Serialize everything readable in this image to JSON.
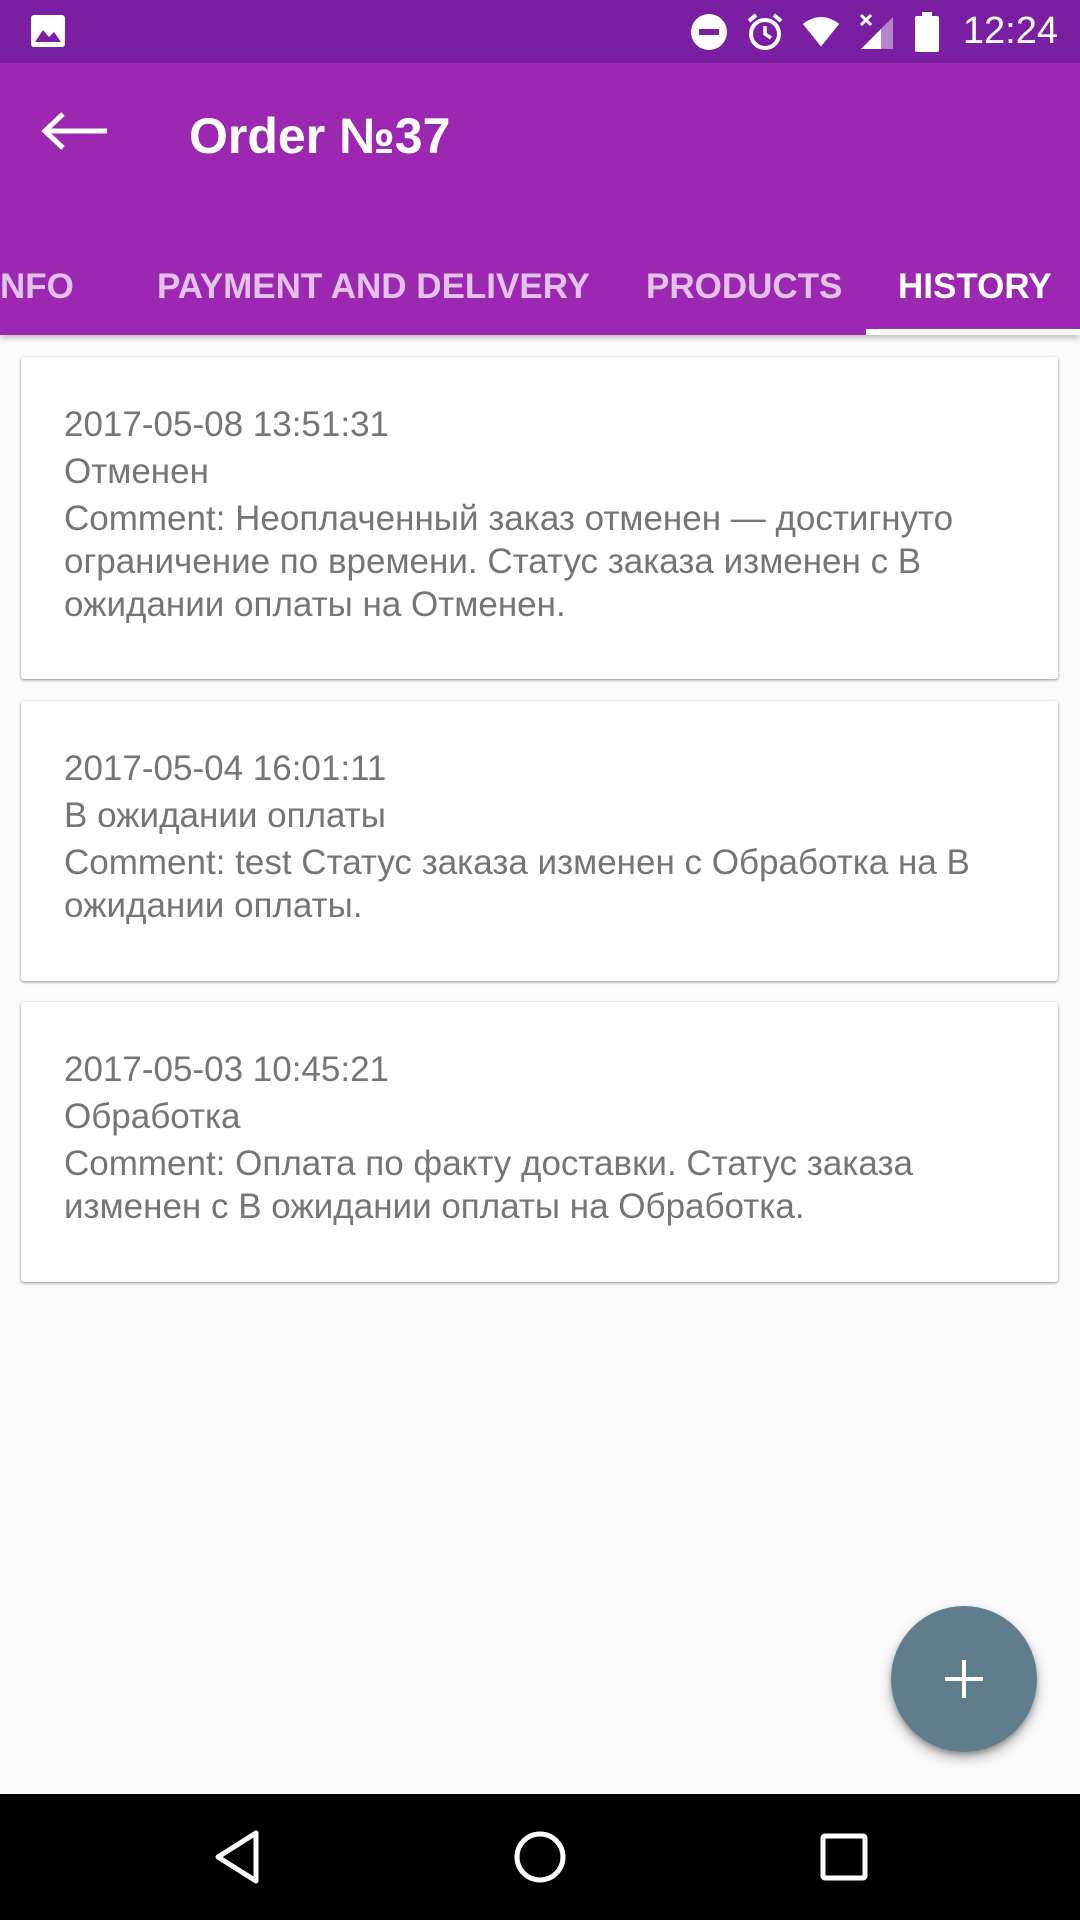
{
  "status_bar": {
    "time": "12:24",
    "icons": [
      "gallery-icon",
      "do-not-disturb-icon",
      "alarm-icon",
      "wifi-icon",
      "signal-icon",
      "battery-icon"
    ]
  },
  "app_bar": {
    "title": "Order №37",
    "back_icon": "arrow-back-icon",
    "tabs": [
      {
        "label": "NFO",
        "active": false
      },
      {
        "label": "PAYMENT AND DELIVERY",
        "active": false
      },
      {
        "label": "PRODUCTS",
        "active": false
      },
      {
        "label": "HISTORY",
        "active": true
      }
    ]
  },
  "history": [
    {
      "date": "2017-05-08 13:51:31",
      "status": "Отменен",
      "comment": "Comment: Неоплаченный заказ отменен — достигнуто ограничение по времени. Статус заказа изменен с В ожидании оплаты на Отменен."
    },
    {
      "date": "2017-05-04 16:01:11",
      "status": "В ожидании оплаты",
      "comment": "Comment: test Статус заказа изменен с Обработка на В ожидании оплаты."
    },
    {
      "date": "2017-05-03 10:45:21",
      "status": "Обработка",
      "comment": "Comment: Оплата по факту доставки. Статус заказа изменен с В ожидании оплаты на Обработка."
    }
  ],
  "fab": {
    "icon": "plus-icon"
  },
  "nav_bar": {
    "icons": [
      "back-triangle-icon",
      "home-circle-icon",
      "recents-square-icon"
    ]
  },
  "colors": {
    "status_bar": "#7b1fa2",
    "app_bar": "#9c27b0",
    "fab": "#607d8b",
    "card_text": "#757575",
    "background": "#fafafa"
  }
}
